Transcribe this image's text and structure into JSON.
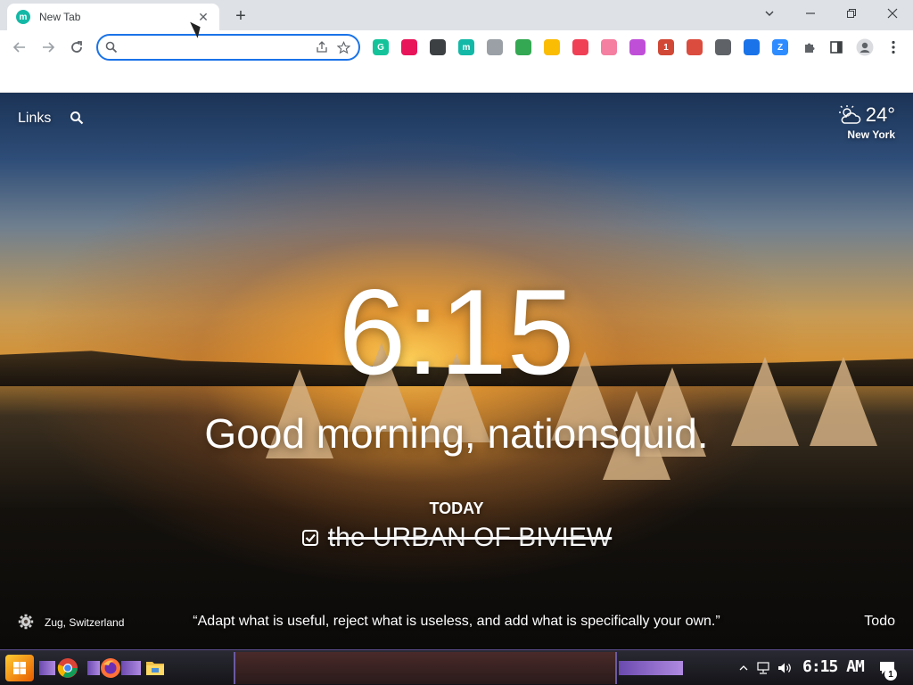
{
  "browser": {
    "tab": {
      "title": "New Tab",
      "favicon_letter": "m"
    },
    "omnibox": {
      "value": "",
      "placeholder": ""
    }
  },
  "extensions": [
    {
      "name": "grammarly-icon",
      "color": "#15c39a",
      "glyph": "G"
    },
    {
      "name": "feather-icon",
      "color": "#e8155b",
      "glyph": ""
    },
    {
      "name": "hexagon-icon",
      "color": "#3c4043",
      "glyph": ""
    },
    {
      "name": "momentum-icon",
      "color": "#14b8a6",
      "glyph": "m"
    },
    {
      "name": "evernote-icon",
      "color": "#9aa0a6",
      "glyph": ""
    },
    {
      "name": "printer-icon",
      "color": "#34a853",
      "glyph": ""
    },
    {
      "name": "google-drive-icon",
      "color": "#fbbc04",
      "glyph": ""
    },
    {
      "name": "pocket-icon",
      "color": "#ef4056",
      "glyph": ""
    },
    {
      "name": "stream-icon",
      "color": "#f47fa0",
      "glyph": ""
    },
    {
      "name": "brain-icon",
      "color": "#c04fd8",
      "glyph": ""
    },
    {
      "name": "badge-icon",
      "color": "#d14836",
      "glyph": "1"
    },
    {
      "name": "todoist-icon",
      "color": "#db4c3f",
      "glyph": ""
    },
    {
      "name": "ublock-icon",
      "color": "#5f6368",
      "glyph": ""
    },
    {
      "name": "wave-icon",
      "color": "#1a73e8",
      "glyph": ""
    },
    {
      "name": "zoom-icon",
      "color": "#2d8cff",
      "glyph": "Z"
    }
  ],
  "momentum": {
    "links_label": "Links",
    "weather": {
      "temp": "24°",
      "city": "New York"
    },
    "clock": "6:15",
    "greeting": "Good morning, nationsquid.",
    "today_label": "TODAY",
    "focus": "the URBAN OF BIVIEW",
    "location": "Zug, Switzerland",
    "quote": "“Adapt what is useful, reject what is useless, and add what is specifically your own.”",
    "todo_label": "Todo"
  },
  "taskbar": {
    "time": "6:15 AM",
    "notification_count": "1"
  }
}
